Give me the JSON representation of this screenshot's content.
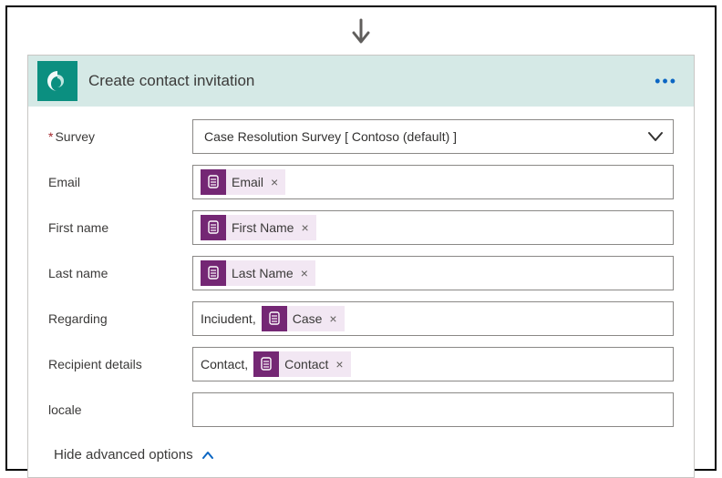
{
  "header": {
    "title": "Create contact invitation",
    "menu_aria": "More options"
  },
  "fields": {
    "survey": {
      "label": "Survey",
      "required": true,
      "value": "Case Resolution Survey  [ Contoso (default) ]"
    },
    "email": {
      "label": "Email",
      "tokens": [
        {
          "label": "Email",
          "icon": "entity-icon"
        }
      ]
    },
    "first_name": {
      "label": "First name",
      "tokens": [
        {
          "label": "First Name",
          "icon": "entity-icon"
        }
      ]
    },
    "last_name": {
      "label": "Last name",
      "tokens": [
        {
          "label": "Last Name",
          "icon": "entity-icon"
        }
      ]
    },
    "regarding": {
      "label": "Regarding",
      "lead_text": "Inciudent,",
      "tokens": [
        {
          "label": "Case",
          "icon": "entity-icon"
        }
      ]
    },
    "recipient_details": {
      "label": "Recipient details",
      "lead_text": "Contact,",
      "tokens": [
        {
          "label": "Contact",
          "icon": "entity-icon"
        }
      ]
    },
    "locale": {
      "label": "locale",
      "value": ""
    }
  },
  "advanced": {
    "toggle_label": "Hide advanced options"
  }
}
